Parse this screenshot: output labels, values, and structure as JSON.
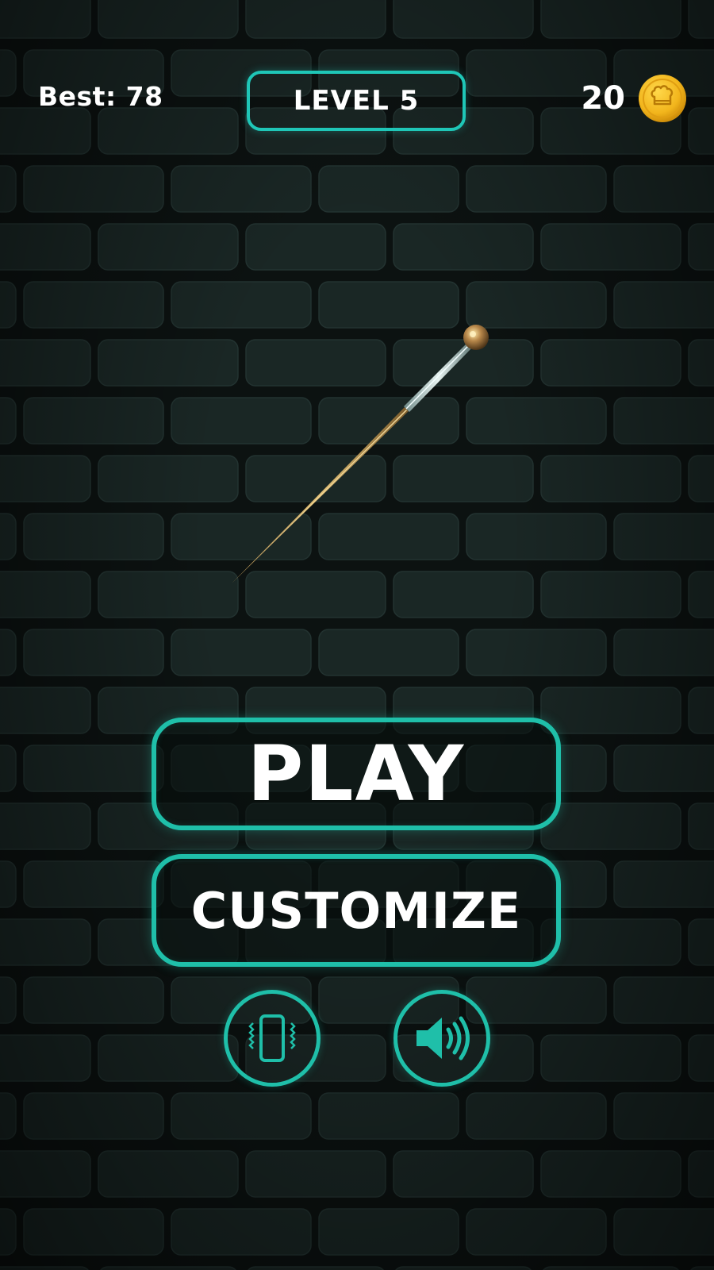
{
  "hud": {
    "best_label": "Best: 78",
    "level_label": "LEVEL 5",
    "coin_count": "20",
    "coin_icon": "chef-hat-coin-icon"
  },
  "menu": {
    "play_label": "PLAY",
    "customize_label": "CUSTOMIZE"
  },
  "toggles": {
    "vibration_icon": "phone-vibrate-icon",
    "sound_icon": "speaker-sound-on-icon"
  },
  "colors": {
    "accent": "#1fc6b7",
    "background": "#0c1211",
    "brick": "#1a2725",
    "coin": "#f2b51c",
    "text": "#ffffff"
  }
}
